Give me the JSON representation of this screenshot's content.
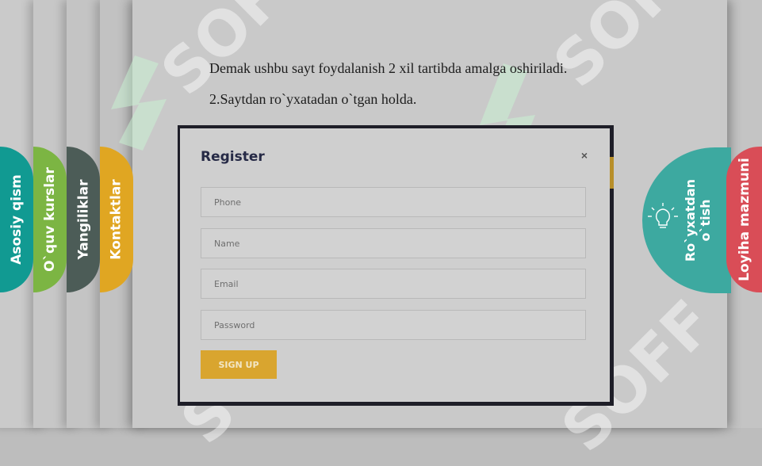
{
  "slide": {
    "line1": "Demak ushbu sayt foydalanish 2 xil tartibda amalga oshiriladi.",
    "line2": "2.Saytdan ro`yxatadan o`tgan holda."
  },
  "left_tabs": [
    {
      "label": "Asosiy qism",
      "color": "#119a92"
    },
    {
      "label": "O`quv kurslar",
      "color": "#7cb543"
    },
    {
      "label": "Yangiliklar",
      "color": "#4c5c57"
    },
    {
      "label": "Kontaktlar",
      "color": "#e0a622"
    }
  ],
  "right_tabs": {
    "active": {
      "label_line1": "Ro`yxatdan",
      "label_line2": "o`tish",
      "icon": "lightbulb-icon",
      "color": "#3da9a0"
    },
    "last": {
      "label": "Loyiha mazmuni",
      "color": "#d94d57"
    }
  },
  "register_modal": {
    "title": "Register",
    "close": "×",
    "phone_placeholder": "Phone",
    "name_placeholder": "Name",
    "email_placeholder": "Email",
    "password_placeholder": "Password",
    "submit_label": "SIGN UP",
    "submit_color": "#d9a52f"
  },
  "watermark": "SOFF"
}
